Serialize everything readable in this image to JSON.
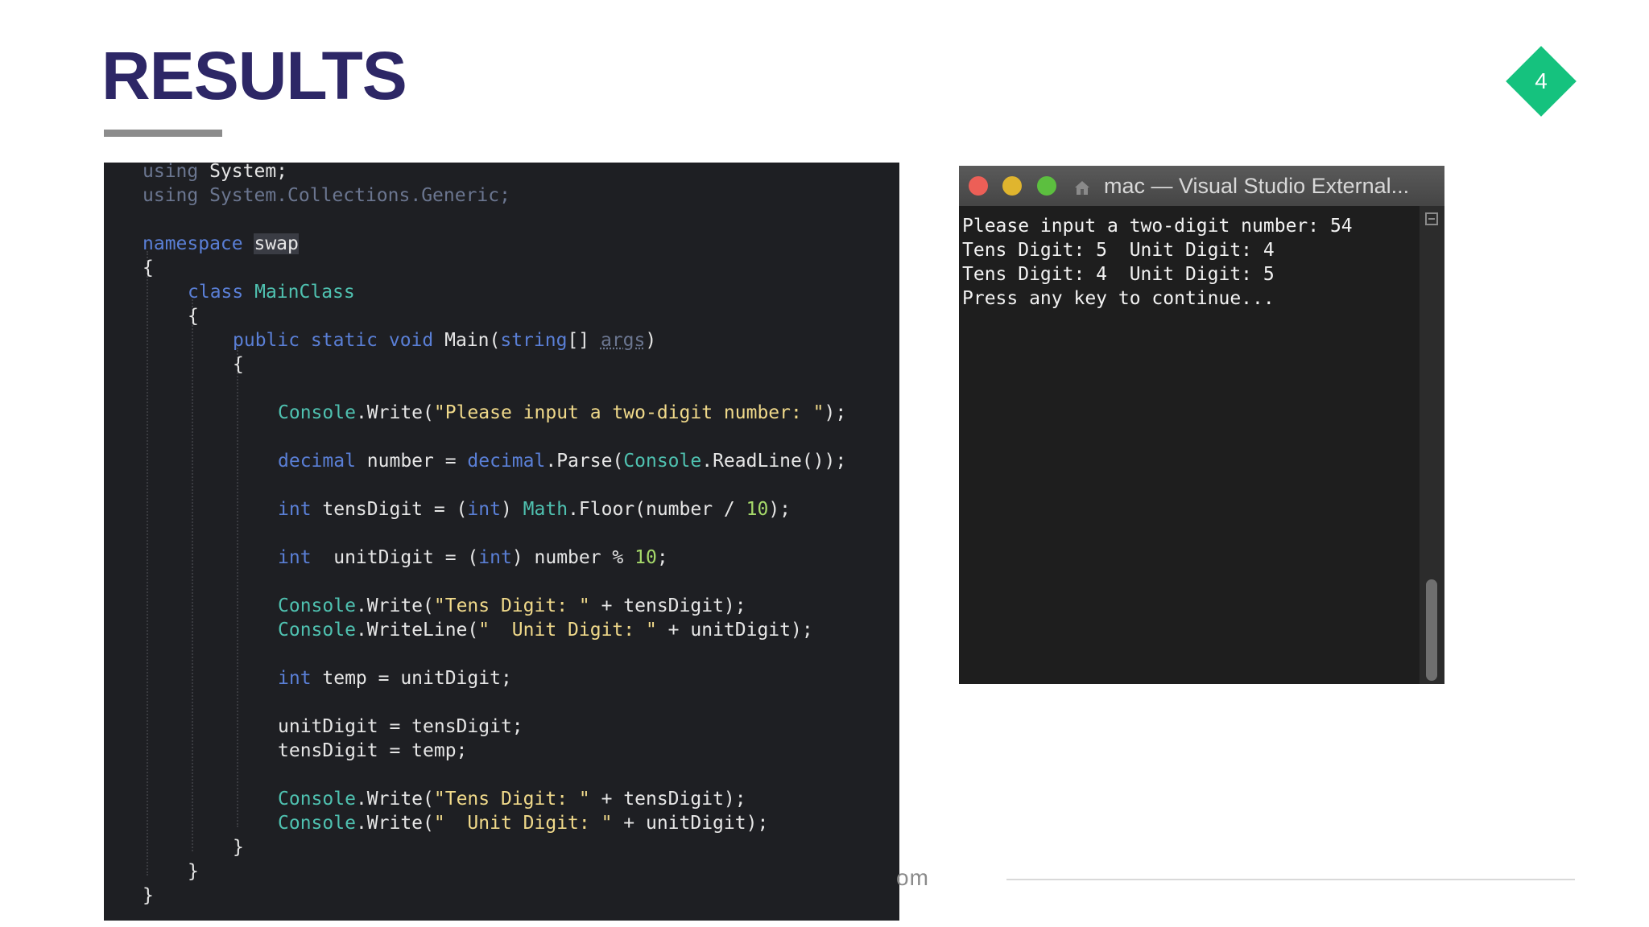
{
  "slide": {
    "title": "RESULTS",
    "page_number": "4",
    "footer_text": "om"
  },
  "colors": {
    "title": "#2d2766",
    "badge": "#15c27e",
    "underline": "#8c8c8c",
    "code_background": "#1e1f23",
    "terminal_background": "#1e1e1e"
  },
  "code": {
    "line_1": [
      "using",
      " System;"
    ],
    "line_2": [
      "using",
      " System.Collections.Generic;"
    ],
    "line_3": [
      "namespace",
      " ",
      "swap"
    ],
    "line_4": "{",
    "line_5": [
      "class",
      " ",
      "MainClass"
    ],
    "line_6": "{",
    "line_7": [
      "public static void",
      " Main(",
      "string",
      "[] ",
      "args",
      ")"
    ],
    "line_8": "{",
    "line_9": [
      "Console",
      ".Write(",
      "\"Please input a two-digit number: \"",
      ");"
    ],
    "line_10": [
      "decimal",
      " number = ",
      "decimal",
      ".Parse(",
      "Console",
      ".ReadLine());"
    ],
    "line_11": [
      "int",
      " tensDigit = (",
      "int",
      ") ",
      "Math",
      ".Floor(number / ",
      "10",
      ");"
    ],
    "line_12": [
      "int",
      "  unitDigit = (",
      "int",
      ") number % ",
      "10",
      ";"
    ],
    "line_13": [
      "Console",
      ".Write(",
      "\"Tens Digit: \"",
      " + tensDigit);"
    ],
    "line_14": [
      "Console",
      ".WriteLine(",
      "\"  Unit Digit: \"",
      " + unitDigit);"
    ],
    "line_15": [
      "int",
      " temp = unitDigit;"
    ],
    "line_16": "unitDigit = tensDigit;",
    "line_17": "tensDigit = temp;",
    "line_18": [
      "Console",
      ".Write(",
      "\"Tens Digit: \"",
      " + tensDigit);"
    ],
    "line_19": [
      "Console",
      ".Write(",
      "\"  Unit Digit: \"",
      " + unitDigit);"
    ],
    "line_20": "}",
    "line_21": "}",
    "line_22": "}"
  },
  "terminal": {
    "title": "mac — Visual Studio External...",
    "lines": [
      "Please input a two-digit number: 54",
      "Tens Digit: 5  Unit Digit: 4",
      "Tens Digit: 4  Unit Digit: 5",
      "Press any key to continue..."
    ],
    "icons": {
      "close": "close-button-icon",
      "minimize": "minimize-button-icon",
      "zoom": "zoom-button-icon",
      "folder": "home-folder-icon",
      "scroll_menu": "menu-icon"
    }
  }
}
